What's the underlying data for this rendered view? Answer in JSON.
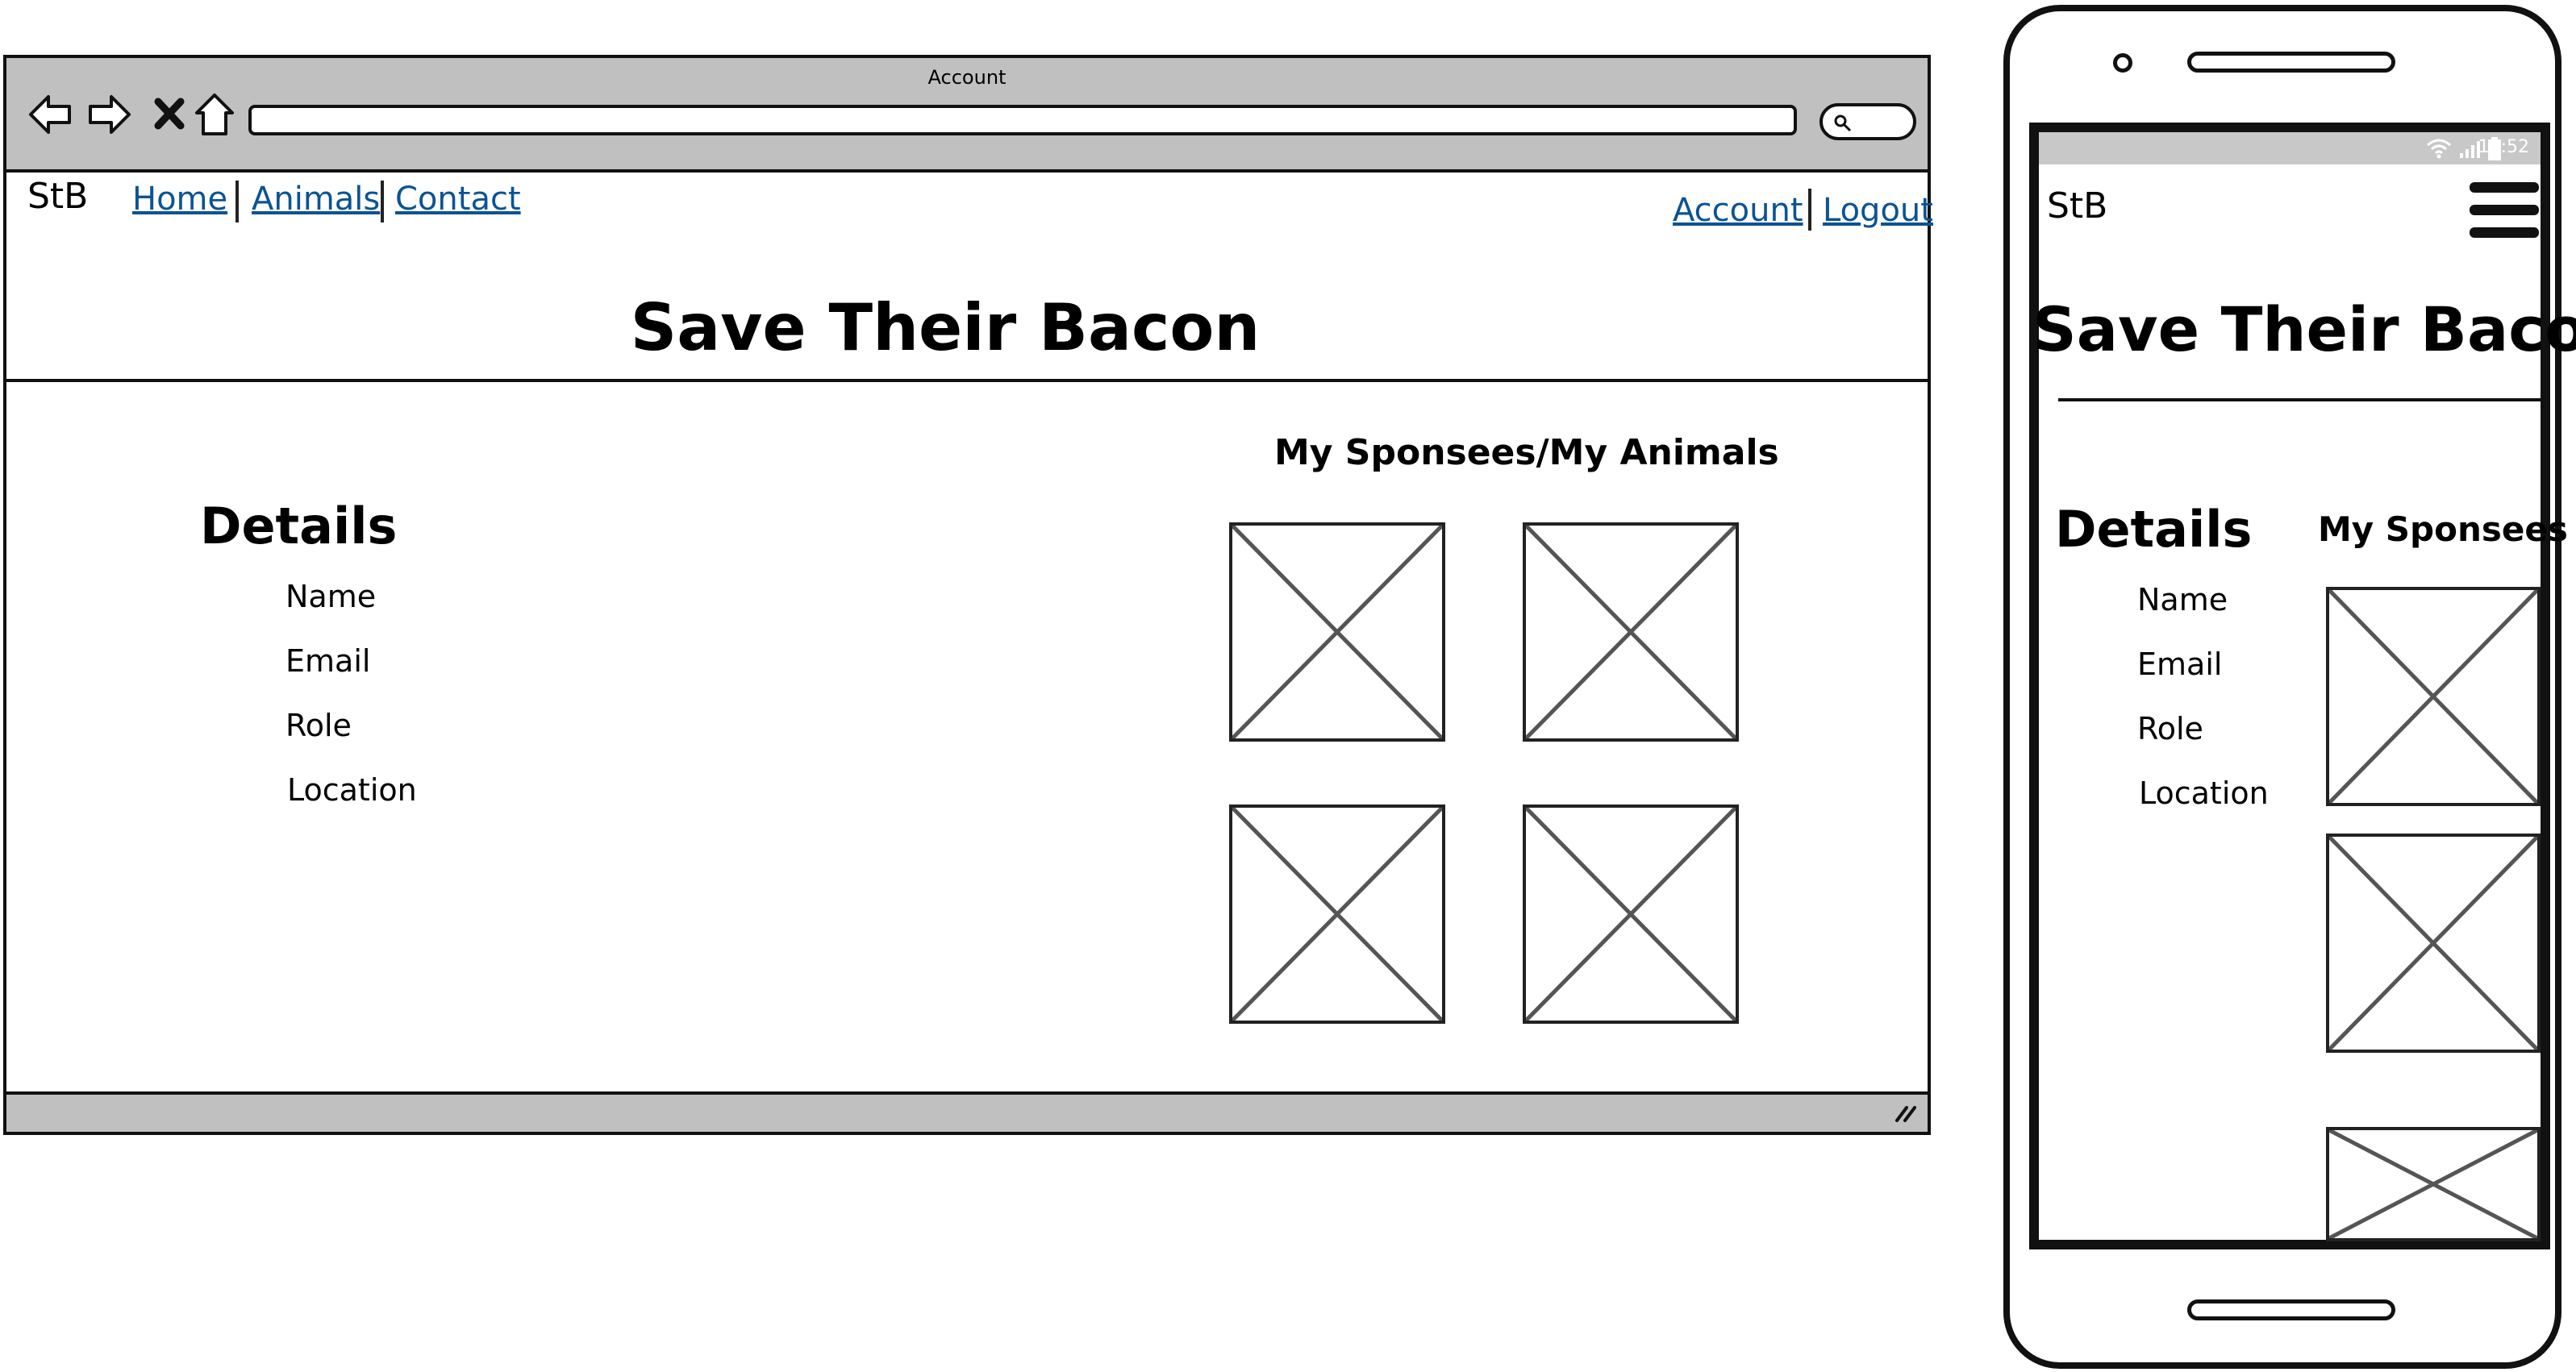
{
  "browser": {
    "window_title": "Account",
    "logo": "StB",
    "nav_left": [
      "Home",
      "Animals",
      "Contact"
    ],
    "nav_right": [
      "Account",
      "Logout"
    ],
    "page_title": "Save Their Bacon",
    "details": {
      "heading": "Details",
      "fields": [
        "Name",
        "Email",
        "Role",
        "Location"
      ]
    },
    "sponsees": {
      "heading": "My Sponsees/My Animals",
      "image_count": 4
    }
  },
  "phone": {
    "status_time": "11:52",
    "logo": "StB",
    "page_title": "Save Their Bacon",
    "details": {
      "heading": "Details",
      "fields": [
        "Name",
        "Email",
        "Role",
        "Location"
      ]
    },
    "sponsees": {
      "heading": "My Sponsees",
      "image_count": 3
    }
  },
  "icons": [
    "back-arrow-icon",
    "forward-arrow-icon",
    "close-icon",
    "home-icon",
    "search-icon",
    "resize-grip-icon",
    "wifi-icon",
    "signal-icon",
    "battery-icon",
    "hamburger-menu-icon"
  ],
  "colors": {
    "link": "#0b5394",
    "chrome": "#c0c0c0",
    "border": "#111111"
  }
}
